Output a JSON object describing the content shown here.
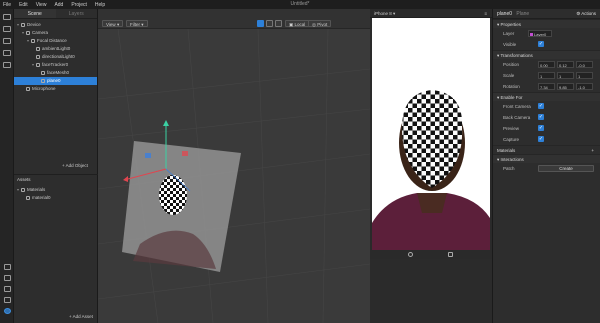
{
  "window_title": "Untitled*",
  "menu": [
    "File",
    "Edit",
    "View",
    "Add",
    "Project",
    "Help"
  ],
  "scene_panel": {
    "tabs": [
      "Scene",
      "Layers"
    ],
    "tree": [
      {
        "label": "Device",
        "depth": 0,
        "twisty": "▾"
      },
      {
        "label": "Camera",
        "depth": 1,
        "twisty": "▾"
      },
      {
        "label": "Focal Distance",
        "depth": 2,
        "twisty": "▾"
      },
      {
        "label": "ambientLight0",
        "depth": 3,
        "twisty": ""
      },
      {
        "label": "directionalLight0",
        "depth": 3,
        "twisty": ""
      },
      {
        "label": "faceTracker0",
        "depth": 3,
        "twisty": "▾"
      },
      {
        "label": "faceMesh0",
        "depth": 4,
        "twisty": ""
      },
      {
        "label": "plane0",
        "depth": 4,
        "twisty": "",
        "selected": true
      },
      {
        "label": "Microphone",
        "depth": 1,
        "twisty": ""
      }
    ],
    "add_object": "+ Add Object"
  },
  "assets_panel": {
    "title": "Assets",
    "items": [
      {
        "label": "Materials",
        "depth": 0,
        "twisty": "▾"
      },
      {
        "label": "material0",
        "depth": 1,
        "twisty": ""
      }
    ],
    "add_asset": "+ Add Asset"
  },
  "viewport": {
    "view_label": "View",
    "filter_label": "Filter",
    "local_label": "Local",
    "pivot_label": "Pivot"
  },
  "simulator": {
    "device": "iPhone 8"
  },
  "properties": {
    "title": "plane0",
    "subtitle": "Plane",
    "actions_label": "Actions",
    "section_properties": "Properties",
    "layer_label": "Layer",
    "layer_value": "Layer0",
    "visible_label": "Visible",
    "section_transformations": "Transformations",
    "position_label": "Position",
    "position": [
      "0.00",
      "0.12",
      "-0.0"
    ],
    "scale_label": "Scale",
    "scale": [
      "1",
      "1",
      "1"
    ],
    "rotation_label": "Rotation",
    "rotation": [
      "7.34",
      "9.85",
      "-1.0"
    ],
    "section_enable_for": "Enable For",
    "front_camera_label": "Front Camera",
    "back_camera_label": "Back Camera",
    "preview_label": "Preview",
    "capture_label": "Capture",
    "materials_label": "Materials",
    "section_interactions": "Interactions",
    "patch_label": "Patch",
    "create_label": "Create"
  },
  "colors": {
    "accent": "#2d80d8",
    "panel": "#2d2d2d",
    "viewport": "#3a3a3a"
  }
}
